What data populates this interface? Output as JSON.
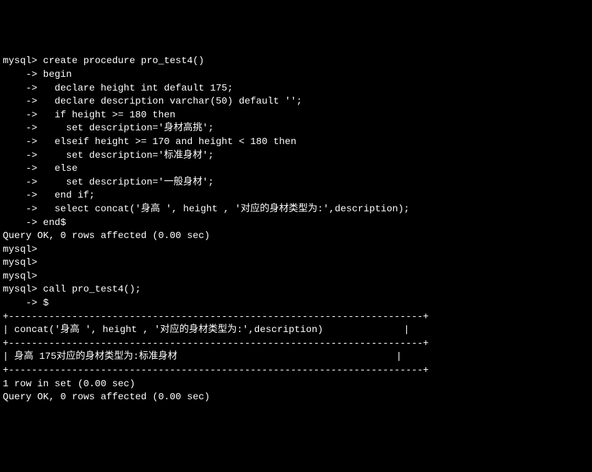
{
  "terminal": {
    "lines": [
      "mysql> create procedure pro_test4()",
      "    -> begin",
      "    ->   declare height int default 175;",
      "    ->   declare description varchar(50) default '';",
      "    ->   if height >= 180 then",
      "    ->     set description='身材高挑';",
      "    ->   elseif height >= 170 and height < 180 then",
      "    ->     set description='标准身材';",
      "    ->   else",
      "    ->     set description='一般身材';",
      "    ->   end if;",
      "    ->   select concat('身高 ', height , '对应的身材类型为:',description);",
      "    -> end$",
      "Query OK, 0 rows affected (0.00 sec)",
      "",
      "mysql>",
      "mysql>",
      "mysql>",
      "mysql> call pro_test4();",
      "    -> $",
      "+------------------------------------------------------------------------+",
      "| concat('身高 ', height , '对应的身材类型为:',description)              |",
      "+------------------------------------------------------------------------+",
      "| 身高 175对应的身材类型为:标准身材                                      |",
      "+------------------------------------------------------------------------+",
      "1 row in set (0.00 sec)",
      "",
      "Query OK, 0 rows affected (0.00 sec)"
    ]
  }
}
